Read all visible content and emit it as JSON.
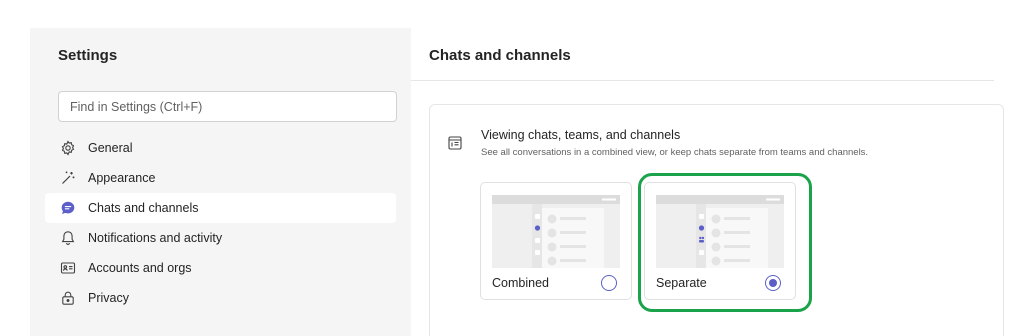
{
  "sidebar": {
    "title": "Settings",
    "search_placeholder": "Find in Settings (Ctrl+F)",
    "items": [
      {
        "label": "General",
        "icon": "gear-icon"
      },
      {
        "label": "Appearance",
        "icon": "magic-wand-icon"
      },
      {
        "label": "Chats and channels",
        "icon": "chat-icon",
        "selected": true
      },
      {
        "label": "Notifications and activity",
        "icon": "bell-icon"
      },
      {
        "label": "Accounts and orgs",
        "icon": "id-card-icon"
      },
      {
        "label": "Privacy",
        "icon": "lock-icon"
      }
    ]
  },
  "main": {
    "title": "Chats and channels",
    "section": {
      "heading": "Viewing chats, teams, and channels",
      "description": "See all conversations in a combined view, or keep chats separate from teams and channels.",
      "icon": "layout-icon",
      "options": [
        {
          "label": "Combined",
          "selected": false
        },
        {
          "label": "Separate",
          "selected": true
        }
      ]
    }
  },
  "colors": {
    "accent": "#5b5fc7",
    "highlight": "#1aa34a",
    "pane_background": "#f5f5f5"
  }
}
